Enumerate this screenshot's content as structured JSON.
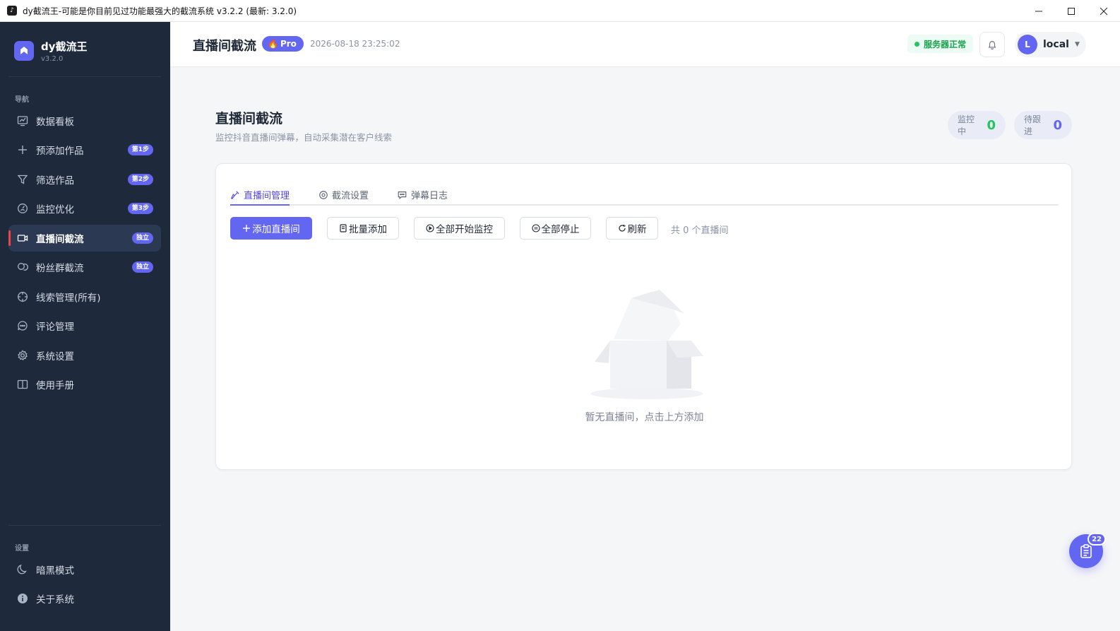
{
  "window": {
    "title": "dy截流王-可能是你目前见过功能最强大的截流系统 v3.2.2 (最新: 3.2.0)",
    "minimize_icon": "minimize-icon",
    "maximize_icon": "maximize-icon",
    "close_icon": "close-icon"
  },
  "sidebar": {
    "brand_name": "dy截流王",
    "brand_version": "v3.2.0",
    "nav_section_label": "导航",
    "items": [
      {
        "label": "数据看板",
        "icon": "chart-icon",
        "badge": ""
      },
      {
        "label": "预添加作品",
        "icon": "plus-icon",
        "badge": "第1步"
      },
      {
        "label": "筛选作品",
        "icon": "filter-icon",
        "badge": "第2步"
      },
      {
        "label": "监控优化",
        "icon": "gauge-icon",
        "badge": "第3步"
      },
      {
        "label": "直播间截流",
        "icon": "video-icon",
        "badge": "独立"
      },
      {
        "label": "粉丝群截流",
        "icon": "group-chat-icon",
        "badge": "独立"
      },
      {
        "label": "线索管理(所有)",
        "icon": "target-icon",
        "badge": ""
      },
      {
        "label": "评论管理",
        "icon": "comment-icon",
        "badge": ""
      },
      {
        "label": "系统设置",
        "icon": "gear-icon",
        "badge": ""
      },
      {
        "label": "使用手册",
        "icon": "book-icon",
        "badge": ""
      }
    ],
    "active_index": 4,
    "settings_section_label": "设置",
    "settings_items": [
      {
        "label": "暗黑模式",
        "icon": "moon-icon"
      },
      {
        "label": "关于系统",
        "icon": "info-icon"
      }
    ]
  },
  "header": {
    "title": "直播间截流",
    "pro_label": "Pro",
    "datetime": "2026-08-18 23:25:02",
    "server_status": "服务器正常",
    "user_initial": "L",
    "user_name": "local"
  },
  "main": {
    "title": "直播间截流",
    "subtitle": "监控抖音直播间弹幕，自动采集潜在客户线索",
    "stats": [
      {
        "label": "监控中",
        "value": "0",
        "color": "#22c55e"
      },
      {
        "label": "待跟进",
        "value": "0",
        "color": "#6366f1"
      }
    ],
    "tabs": [
      {
        "label": "直播间管理",
        "icon": "broom-icon"
      },
      {
        "label": "截流设置",
        "icon": "gear-icon"
      },
      {
        "label": "弹幕日志",
        "icon": "chat-icon"
      }
    ],
    "active_tab": 0,
    "buttons": [
      {
        "label": "添加直播间",
        "icon": "plus-icon",
        "primary": true
      },
      {
        "label": "批量添加",
        "icon": "document-icon",
        "primary": false
      },
      {
        "label": "全部开始监控",
        "icon": "play-circle-icon",
        "primary": false
      },
      {
        "label": "全部停止",
        "icon": "pause-circle-icon",
        "primary": false
      },
      {
        "label": "刷新",
        "icon": "refresh-icon",
        "primary": false
      }
    ],
    "room_count_text": "共 0 个直播间",
    "empty_text": "暂无直播间，点击上方添加"
  },
  "floating": {
    "icon": "clipboard-icon",
    "badge": "22"
  },
  "colors": {
    "sidebar_bg": "#1e2a3b",
    "accent": "#6366f1",
    "success": "#22c55e"
  }
}
